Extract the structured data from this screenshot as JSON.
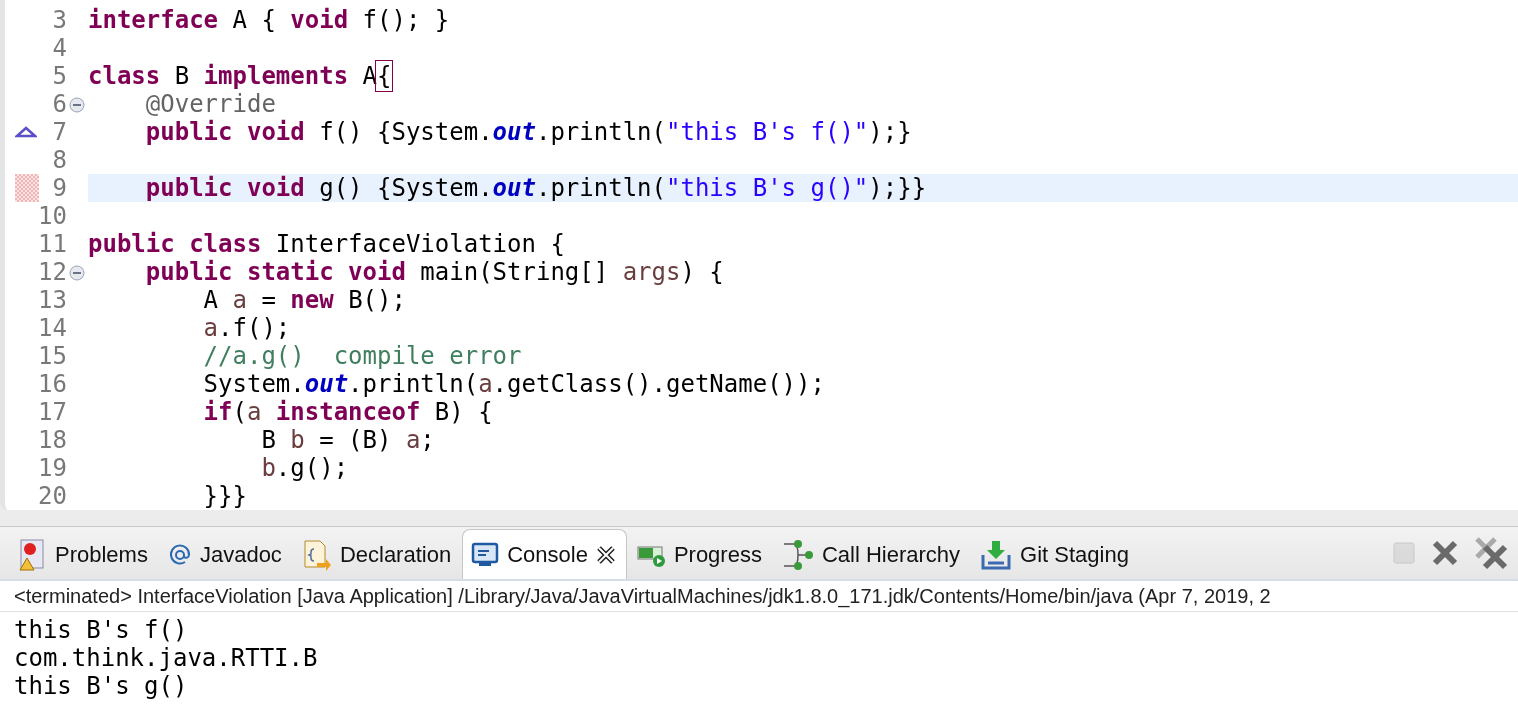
{
  "editor": {
    "lines": [
      {
        "number": "3",
        "kind": "plain",
        "foldable": false,
        "highlighted": false,
        "tokens": [
          {
            "kind": "keyword",
            "text": "interface"
          },
          {
            "kind": "plain",
            "text": " A {"
          },
          {
            "kind": "keyword",
            "text": " void"
          },
          {
            "kind": "plain",
            "text": " f(); }"
          }
        ]
      },
      {
        "number": "4",
        "kind": "plain",
        "foldable": false,
        "highlighted": false
      },
      {
        "number": "5",
        "kind": "plain",
        "foldable": false,
        "highlighted": false,
        "tokens": [
          {
            "kind": "keyword",
            "text": "class"
          },
          {
            "kind": "plain",
            "text": " B"
          },
          {
            "kind": "keyword",
            "text": " implements"
          },
          {
            "kind": "plain",
            "text": " A"
          },
          {
            "kind": "match",
            "text": "{"
          }
        ]
      },
      {
        "number": "6",
        "kind": "plain",
        "foldable": true,
        "highlighted": false,
        "tokens": [
          {
            "kind": "annotation",
            "text": "    @Override"
          }
        ]
      },
      {
        "number": "7",
        "kind": "override",
        "foldable": false,
        "highlighted": false,
        "tokens": [
          {
            "kind": "keyword",
            "text": "    public"
          },
          {
            "kind": "keyword",
            "text": " void"
          },
          {
            "kind": "plain",
            "text": " f() {System."
          },
          {
            "kind": "field",
            "text": "out"
          },
          {
            "kind": "plain",
            "text": ".println("
          },
          {
            "kind": "string",
            "text": "\"this B's f()\""
          },
          {
            "kind": "plain",
            "text": ");}"
          }
        ]
      },
      {
        "number": "8",
        "kind": "plain",
        "foldable": false,
        "highlighted": false
      },
      {
        "number": "9",
        "kind": "hatch",
        "foldable": false,
        "highlighted": true,
        "tokens": [
          {
            "kind": "keyword",
            "text": "    public"
          },
          {
            "kind": "keyword",
            "text": " void"
          },
          {
            "kind": "plain",
            "text": " g() {System."
          },
          {
            "kind": "field",
            "text": "out"
          },
          {
            "kind": "plain",
            "text": ".println("
          },
          {
            "kind": "string",
            "text": "\"this B's g()\""
          },
          {
            "kind": "plain",
            "text": ");}}"
          }
        ]
      },
      {
        "number": "10",
        "kind": "plain",
        "foldable": false,
        "highlighted": false
      },
      {
        "number": "11",
        "kind": "plain",
        "foldable": false,
        "highlighted": false,
        "tokens": [
          {
            "kind": "keyword",
            "text": "public"
          },
          {
            "kind": "keyword",
            "text": " class"
          },
          {
            "kind": "plain",
            "text": " InterfaceViolation {"
          }
        ]
      },
      {
        "number": "12",
        "kind": "plain",
        "foldable": true,
        "highlighted": false,
        "tokens": [
          {
            "kind": "keyword",
            "text": "    public"
          },
          {
            "kind": "keyword",
            "text": " static"
          },
          {
            "kind": "keyword",
            "text": " void"
          },
          {
            "kind": "plain",
            "text": " main(String[]"
          },
          {
            "kind": "local",
            "text": " args"
          },
          {
            "kind": "plain",
            "text": ") {"
          }
        ]
      },
      {
        "number": "13",
        "kind": "plain",
        "foldable": false,
        "highlighted": false,
        "tokens": [
          {
            "kind": "plain",
            "text": "        A"
          },
          {
            "kind": "local",
            "text": " a"
          },
          {
            "kind": "plain",
            "text": " ="
          },
          {
            "kind": "keyword",
            "text": " new"
          },
          {
            "kind": "plain",
            "text": " B();"
          }
        ]
      },
      {
        "number": "14",
        "kind": "plain",
        "foldable": false,
        "highlighted": false,
        "tokens": [
          {
            "kind": "local",
            "text": "        a"
          },
          {
            "kind": "plain",
            "text": ".f();"
          }
        ]
      },
      {
        "number": "15",
        "kind": "plain",
        "foldable": false,
        "highlighted": false,
        "tokens": [
          {
            "kind": "comment",
            "text": "        //a.g()  compile error"
          }
        ]
      },
      {
        "number": "16",
        "kind": "plain",
        "foldable": false,
        "highlighted": false,
        "tokens": [
          {
            "kind": "plain",
            "text": "        System."
          },
          {
            "kind": "field",
            "text": "out"
          },
          {
            "kind": "plain",
            "text": ".println("
          },
          {
            "kind": "local",
            "text": "a"
          },
          {
            "kind": "plain",
            "text": ".getClass().getName());"
          }
        ]
      },
      {
        "number": "17",
        "kind": "plain",
        "foldable": false,
        "highlighted": false,
        "tokens": [
          {
            "kind": "keyword",
            "text": "        if"
          },
          {
            "kind": "plain",
            "text": "("
          },
          {
            "kind": "local",
            "text": "a"
          },
          {
            "kind": "keyword",
            "text": " instanceof"
          },
          {
            "kind": "plain",
            "text": " B) {"
          }
        ]
      },
      {
        "number": "18",
        "kind": "plain",
        "foldable": false,
        "highlighted": false,
        "tokens": [
          {
            "kind": "plain",
            "text": "            B"
          },
          {
            "kind": "local",
            "text": " b"
          },
          {
            "kind": "plain",
            "text": " = (B)"
          },
          {
            "kind": "local",
            "text": " a"
          },
          {
            "kind": "plain",
            "text": ";"
          }
        ]
      },
      {
        "number": "19",
        "kind": "plain",
        "foldable": false,
        "highlighted": false,
        "tokens": [
          {
            "kind": "local",
            "text": "            b"
          },
          {
            "kind": "plain",
            "text": ".g();"
          }
        ]
      },
      {
        "number": "20",
        "kind": "plain",
        "foldable": false,
        "highlighted": false,
        "tokens": [
          {
            "kind": "plain",
            "text": "        }}}"
          }
        ]
      }
    ]
  },
  "panel": {
    "tabs": [
      {
        "label": "Problems",
        "selected": false
      },
      {
        "label": "Javadoc",
        "selected": false
      },
      {
        "label": "Declaration",
        "selected": false
      },
      {
        "label": "Console",
        "selected": true
      },
      {
        "label": "Progress",
        "selected": false
      },
      {
        "label": "Call Hierarchy",
        "selected": false
      },
      {
        "label": "Git Staging",
        "selected": false
      }
    ],
    "toolbar": [
      {
        "kind": "stop",
        "disabled": true
      },
      {
        "kind": "remove",
        "disabled": false
      },
      {
        "kind": "remove-all",
        "disabled": false
      }
    ],
    "status": "<terminated> InterfaceViolation [Java Application] /Library/Java/JavaVirtualMachines/jdk1.8.0_171.jdk/Contents/Home/bin/java (Apr 7, 2019, 2",
    "output": [
      "this B's f()",
      "com.think.java.RTTI.B",
      "this B's g()"
    ]
  }
}
